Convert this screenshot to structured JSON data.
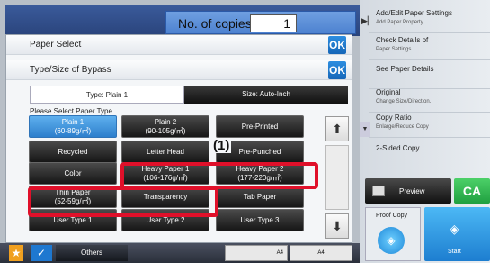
{
  "copies": {
    "label": "No. of copies",
    "value": "1"
  },
  "dialog": {
    "paper_select": "Paper Select",
    "type_size": "Type/Size of Bypass",
    "ok": "OK",
    "tab_type": "Type:  Plain 1",
    "tab_size": "Size:  Auto-Inch",
    "instruction": "Please Select Paper Type.",
    "buttons": [
      {
        "l1": "Plain 1",
        "l2": "(60-89g/㎡)"
      },
      {
        "l1": "Plain 2",
        "l2": "(90-105g/㎡)"
      },
      {
        "l1": "Pre-Printed",
        "l2": ""
      },
      {
        "l1": "Recycled",
        "l2": ""
      },
      {
        "l1": "Letter Head",
        "l2": ""
      },
      {
        "l1": "Pre-Punched",
        "l2": ""
      },
      {
        "l1": "Color",
        "l2": ""
      },
      {
        "l1": "Heavy Paper 1",
        "l2": "(106-176g/㎡)"
      },
      {
        "l1": "Heavy Paper 2",
        "l2": "(177-220g/㎡)"
      },
      {
        "l1": "Thin Paper",
        "l2": "(52-59g/㎡)"
      },
      {
        "l1": "Transparency",
        "l2": ""
      },
      {
        "l1": "Tab Paper",
        "l2": ""
      },
      {
        "l1": "User Type 1",
        "l2": ""
      },
      {
        "l1": "User Type 2",
        "l2": ""
      },
      {
        "l1": "User Type 3",
        "l2": ""
      }
    ],
    "callout": "(1)"
  },
  "bottom": {
    "others": "Others",
    "tray1": "A4",
    "tray2": "A4"
  },
  "right": {
    "items": [
      {
        "main": "Add/Edit Paper Settings",
        "sub": "Add Paper Property"
      },
      {
        "main": "Check Details of",
        "sub": "Paper Settings"
      },
      {
        "main": "See Paper Details",
        "sub": ""
      },
      {
        "main": "Original",
        "sub": "Change Size/Direction."
      },
      {
        "main": "Copy Ratio",
        "sub": "Enlarge/Reduce Copy"
      },
      {
        "main": "2-Sided Copy",
        "sub": ""
      }
    ],
    "preview": "Preview",
    "ca": "CA",
    "proof": "Proof Copy",
    "start": "Start"
  },
  "colors": {
    "selected": "#3b8fd8",
    "highlight": "#e0102a",
    "ca": "#2bb34a"
  }
}
